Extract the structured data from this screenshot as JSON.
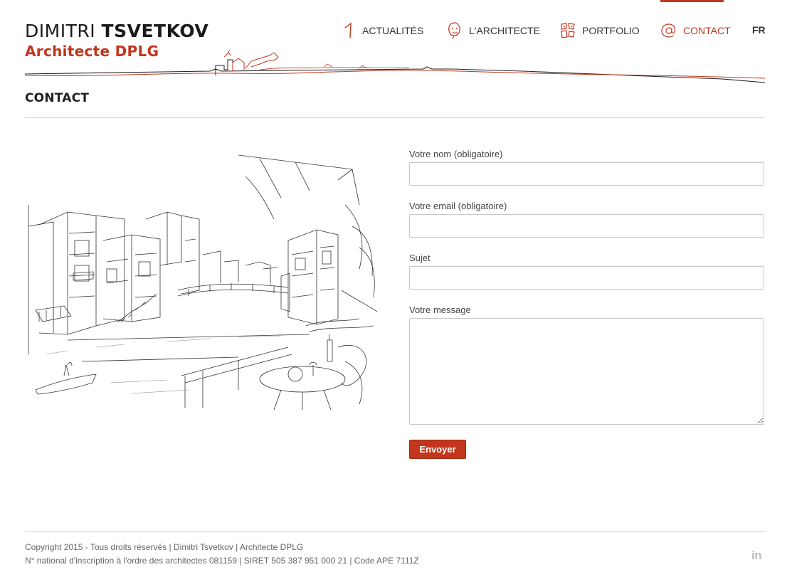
{
  "brand": {
    "first_name": "DIMITRI",
    "last_name": "TSVETKOV",
    "subtitle": "Architecte DPLG"
  },
  "nav": {
    "items": [
      {
        "label": "ACTUALITÉS",
        "icon": "one-icon"
      },
      {
        "label": "L'ARCHITECTE",
        "icon": "face-icon"
      },
      {
        "label": "PORTFOLIO",
        "icon": "portfolio-icon"
      },
      {
        "label": "CONTACT",
        "icon": "at-icon",
        "active": true
      }
    ],
    "language": "FR"
  },
  "page": {
    "title": "CONTACT"
  },
  "form": {
    "name_label": "Votre nom (obligatoire)",
    "email_label": "Votre email (obligatoire)",
    "subject_label": "Sujet",
    "message_label": "Votre message",
    "submit_label": "Envoyer"
  },
  "footer": {
    "line1": "Copyright 2015 - Tous droits réservés | Dimitri Tsvetkov | Architecte DPLG",
    "line2": "N° national d'inscription à l'ordre des architectes 081159 | SIRET 505 387 951 000 21 | Code APE 7111Z",
    "social_icon": "linkedin-icon",
    "social_text": "in"
  },
  "colors": {
    "accent": "#c1361c",
    "text": "#333333",
    "rule": "#cfcfcf"
  }
}
